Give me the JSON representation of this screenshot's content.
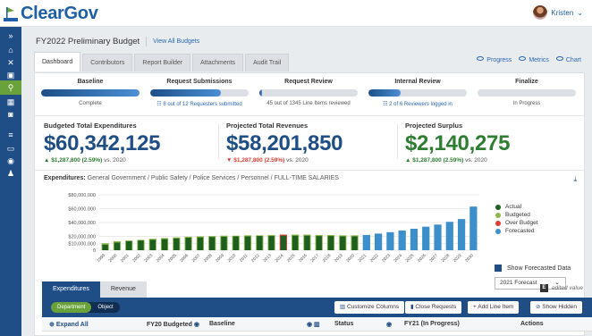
{
  "app": {
    "logo_text": "ClearGov",
    "user_name": "Kristen"
  },
  "colors": {
    "primary": "#1f4e86",
    "accent_green": "#69a23b",
    "link": "#2a67b1",
    "negative": "#e03c31",
    "actual": "#1e5e1e",
    "budgeted": "#8ab84a",
    "over_budget": "#e03c31",
    "forecasted": "#3d8fcb"
  },
  "sidebar": {
    "icons": [
      "chevron-double-right",
      "home-icon",
      "tools-icon",
      "calculator-icon",
      "org-chart-icon",
      "gift-icon",
      "doc-icon",
      "database-icon",
      "monitor-icon",
      "chat-icon",
      "users-icon"
    ]
  },
  "page": {
    "title": "FY2022 Preliminary Budget",
    "view_all": "View All Budgets"
  },
  "tabs": [
    "Dashboard",
    "Contributors",
    "Report Builder",
    "Attachments",
    "Audit Trail"
  ],
  "view_links": [
    "Progress",
    "Metrics",
    "Chart"
  ],
  "stages": [
    {
      "name": "Baseline",
      "progress": 1.0,
      "status": "Complete",
      "link": false
    },
    {
      "name": "Request Submissions",
      "progress": 0.72,
      "status": "8 out of 12 Requesters submitted",
      "link": true
    },
    {
      "name": "Request Review",
      "progress": 0.03,
      "status": "45 out of 1345 Line Items reviewed",
      "link": false
    },
    {
      "name": "Internal Review",
      "progress": 0.33,
      "status": "2 of 6 Reviewers logged in",
      "link": true
    },
    {
      "name": "Finalize",
      "progress": 0.0,
      "status": "In Progress",
      "link": false
    }
  ],
  "totals": [
    {
      "label": "Budgeted Total Expenditures",
      "value": "$60,342,125",
      "change": "$1,287,800 (2.59%)",
      "compare": "vs. 2020",
      "direction": "up"
    },
    {
      "label": "Projected Total Revenues",
      "value": "$58,201,850",
      "change": "$1,287,800 (2.59%)",
      "compare": "vs. 2020",
      "direction": "down"
    },
    {
      "label": "Projected Surplus",
      "value": "$2,140,275",
      "change": "$1,287,800 (2.59%)",
      "compare": "vs. 2020",
      "direction": "up"
    }
  ],
  "breadcrumb": {
    "prefix": "Expenditures:",
    "path": "General Government / Public Safety / Police Services / Personnel / FULL-TIME SALARIES"
  },
  "chart_data": {
    "type": "bar",
    "categories": [
      "1999",
      "2000",
      "2001",
      "2002",
      "2003",
      "2004",
      "2005",
      "2006",
      "2007",
      "2008",
      "2009",
      "2010",
      "2011",
      "2012",
      "2013",
      "2014",
      "2015",
      "2016",
      "2017",
      "2018",
      "2019",
      "2020",
      "2021",
      "2022",
      "2023",
      "2024",
      "2025",
      "2026",
      "2027",
      "2028",
      "2029",
      "2030"
    ],
    "series": [
      {
        "name": "Actual",
        "values": [
          8000000,
          11000000,
          13000000,
          14000000,
          15000000,
          16000000,
          17000000,
          18000000,
          18500000,
          19000000,
          19500000,
          20000000,
          20000000,
          20500000,
          20500000,
          21000000,
          21000000,
          21000000,
          20500000,
          20500000,
          20000000,
          20000000,
          null,
          null,
          null,
          null,
          null,
          null,
          null,
          null,
          null,
          null
        ]
      },
      {
        "name": "Budgeted",
        "values": [
          10000000,
          13000000,
          14000000,
          15000000,
          16500000,
          17500000,
          18500000,
          19500000,
          20000000,
          20500000,
          21000000,
          21000000,
          21500000,
          21500000,
          22000000,
          null,
          22500000,
          22500000,
          22000000,
          22000000,
          21500000,
          21500000,
          null,
          null,
          null,
          null,
          null,
          null,
          null,
          null,
          null,
          null
        ]
      },
      {
        "name": "Over Budget",
        "values": [
          null,
          null,
          null,
          null,
          null,
          null,
          null,
          null,
          null,
          null,
          null,
          null,
          null,
          null,
          null,
          22500000,
          null,
          null,
          null,
          null,
          null,
          null,
          null,
          null,
          null,
          null,
          null,
          null,
          null,
          null,
          null,
          null
        ]
      },
      {
        "name": "Forecasted",
        "values": [
          null,
          null,
          null,
          null,
          null,
          null,
          null,
          null,
          null,
          null,
          null,
          null,
          null,
          null,
          null,
          null,
          null,
          null,
          null,
          null,
          null,
          null,
          22000000,
          24000000,
          26000000,
          28500000,
          31000000,
          34000000,
          37000000,
          41000000,
          45000000,
          51000000
        ]
      }
    ],
    "extra_last": {
      "category": "2030",
      "value": 63000000
    },
    "yticks": [
      "$80,000,000",
      "$60,000,000",
      "$40,000,000",
      "$20,000,000",
      "$10,000,000",
      "0"
    ],
    "ylim": [
      0,
      80000000
    ],
    "legend_position": "right",
    "grid": true
  },
  "forecast": {
    "show_label": "Show Forecasted Data",
    "selected": "2021 Forecast"
  },
  "bottom": {
    "tabs": [
      "Expenditures",
      "Revenue"
    ],
    "edited_label": "edited value",
    "edited_box": "E",
    "pills": [
      "Department",
      "Object"
    ],
    "buttons": [
      "Customize Columns",
      "Close Requests",
      "+ Add Line Item",
      "Show Hidden"
    ],
    "columns": [
      "Expand All",
      "FY20 Budgeted",
      "Baseline",
      "Status",
      "FY21 (In Progress)",
      "Actions"
    ]
  }
}
